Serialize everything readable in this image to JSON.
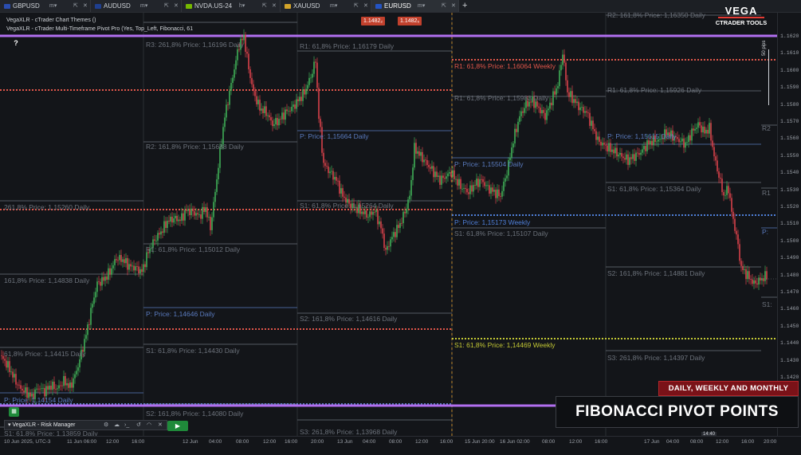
{
  "tabs": [
    {
      "symbol": "GBPUSD",
      "flag": "#2a4db0",
      "active": false
    },
    {
      "symbol": "AUDUSD",
      "flag": "#1f3f8f",
      "active": false
    },
    {
      "symbol": "NVDA.US-24",
      "flag": "#76b900",
      "active": false
    },
    {
      "symbol": "XAUUSD",
      "flag": "#d4a52a",
      "active": false
    },
    {
      "symbol": "EURUSD",
      "flag": "#2454c4",
      "active": true
    }
  ],
  "tab_timeframes": [
    "m",
    "m",
    "h",
    "m",
    "m"
  ],
  "add_tab": "+",
  "info": {
    "line1": "VegaXLR - cTrader Chart Themes ()",
    "line2": "VegaXLR - cTrader Multi-Timeframe Pivot Pro (Yes, Top_Left, Fibonacci, 61"
  },
  "help": "?",
  "bid": "1.1482₂",
  "ask": "1.1482₅",
  "logo": {
    "brand": "VEGA",
    "sub": "CTRADER TOOLS"
  },
  "banner_top": "DAILY, WEEKLY AND MONTHLY",
  "banner_main": "FIBONACCI PIVOT POINTS",
  "risk_manager": {
    "title": "VegaXLR - Risk Manager"
  },
  "magnify_label": "50 pips",
  "tz_label": "14:40",
  "y_ticks": [
    "1.1620",
    "1.1610",
    "1.1600",
    "1.1590",
    "1.1580",
    "1.1570",
    "1.1560",
    "1.1550",
    "1.1540",
    "1.1530",
    "1.1520",
    "1.1510",
    "1.1500",
    "1.1490",
    "1.1480",
    "1.1470",
    "1.1460",
    "1.1450",
    "1.1440",
    "1.1430",
    "1.1420"
  ],
  "x_ticks": [
    "10 Jun 2025, UTC-3",
    "11 Jun 06:00",
    "12:00",
    "16:00",
    "12 Jun",
    "04:00",
    "08:00",
    "12:00",
    "16:00",
    "20:00",
    "13 Jun",
    "04:00",
    "08:00",
    "12:00",
    "16:00",
    "15 Jun 20:00",
    "16 Jun 02:00",
    "08:00",
    "12:00",
    "16:00",
    "17 Jun",
    "04:00",
    "08:00",
    "12:00",
    "16:00",
    "20:00"
  ],
  "pivot_labels": [
    {
      "text": "R3: 261,8% Price: 1,16196 Daily",
      "color": "#6d737c"
    },
    {
      "text": "R1: 61,8% Price: 1,16179 Daily",
      "color": "#6d737c"
    },
    {
      "text": "R1: 61,8% Price: 1,16064 Weekly",
      "color": "#e0564a"
    },
    {
      "text": "R2: 161,8% Price: 1,16350 Daily",
      "color": "#6d737c"
    },
    {
      "text": "R1: 61,8% Price: 1,15983 Daily",
      "color": "#6d737c"
    },
    {
      "text": "R1: 61,8% Price: 1,15926 Daily",
      "color": "#6d737c"
    },
    {
      "text": "R2: 161,8% Price: 1,15688 Daily",
      "color": "#6d737c"
    },
    {
      "text": "P:  Price: 1,15664 Daily",
      "color": "#5a7bbf"
    },
    {
      "text": "P:  Price: 1,15615 Daily",
      "color": "#5a7bbf"
    },
    {
      "text": "P:  Price: 1,15504 Daily",
      "color": "#5a7bbf"
    },
    {
      "text": "S1: 61,8% Price: 1,15364 Daily",
      "color": "#6d737c"
    },
    {
      "text": "261,8% Price: 1,15260 Daily",
      "color": "#6d737c"
    },
    {
      "text": "S1: 61,8% Price: 1,15264 Daily",
      "color": "#6d737c"
    },
    {
      "text": "P:  Price: 1,15173 Weekly",
      "color": "#4f7fd8"
    },
    {
      "text": "S1: 61,8% Price: 1,15107 Daily",
      "color": "#6d737c"
    },
    {
      "text": "R1: 61,8% Price: 1,15012 Daily",
      "color": "#6d737c"
    },
    {
      "text": "S2: 161,8% Price: 1,14881 Daily",
      "color": "#6d737c"
    },
    {
      "text": "161,8% Price: 1,14838 Daily",
      "color": "#6d737c"
    },
    {
      "text": "P:  Price: 1,14646 Daily",
      "color": "#5a7bbf"
    },
    {
      "text": "S2: 161,8% Price: 1,14616 Daily",
      "color": "#6d737c"
    },
    {
      "text": "S1: 61,8% Price: 1,14469 Weekly",
      "color": "#c4c934"
    },
    {
      "text": "S1: 61,8% Price: 1,14430 Daily",
      "color": "#6d737c"
    },
    {
      "text": "61,8% Price: 1,14415 Daily",
      "color": "#6d737c"
    },
    {
      "text": "S3: 261,8% Price: 1,14397 Daily",
      "color": "#6d737c"
    },
    {
      "text": "P:  Price: 1,14154 Daily",
      "color": "#5a7bbf"
    },
    {
      "text": "S2: 161,8% Price: 1,14080 Daily",
      "color": "#6d737c"
    },
    {
      "text": "S3: 261,8% Price: 1,13968 Daily",
      "color": "#6d737c"
    },
    {
      "text": "S1: 61,8% Price: 1,13859 Daily",
      "color": "#6d737c"
    },
    {
      "text": "R2",
      "color": "#6d737c"
    },
    {
      "text": "R1",
      "color": "#6d737c"
    },
    {
      "text": "P:",
      "color": "#5a7bbf"
    },
    {
      "text": "S1:",
      "color": "#6d737c"
    }
  ],
  "colors": {
    "monthly": "#b26ff0",
    "weekly_r": "#e0564a",
    "weekly_p": "#4f7fd8",
    "weekly_s": "#c4c934",
    "bull": "#3fae57",
    "bear": "#d8424a",
    "session": "#c68a2e"
  }
}
